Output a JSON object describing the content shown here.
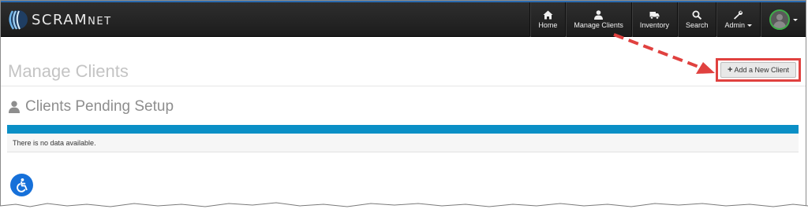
{
  "brand": {
    "name_main": "SCRAM",
    "name_suffix": "NET",
    "logo_icon": "scram-swoosh-logo"
  },
  "nav": {
    "items": [
      {
        "label": "Home",
        "icon": "home-icon"
      },
      {
        "label": "Manage Clients",
        "icon": "user-icon"
      },
      {
        "label": "Inventory",
        "icon": "truck-icon"
      },
      {
        "label": "Search",
        "icon": "search-icon"
      },
      {
        "label": "Admin",
        "icon": "wrench-icon",
        "has_dropdown": true
      }
    ],
    "user_menu": {
      "icon": "avatar-icon",
      "has_dropdown": true
    }
  },
  "page": {
    "title": "Manage Clients",
    "add_button_label": "Add a New Client",
    "add_button_icon": "plus-icon"
  },
  "section": {
    "title": "Clients Pending Setup",
    "icon": "user-icon",
    "empty_message": "There is no data available."
  },
  "accessibility_button": {
    "icon": "accessibility-icon"
  },
  "colors": {
    "navbar": "#222222",
    "accent_blue": "#0a8fc6",
    "highlight_red": "#e0413f",
    "avatar_ring": "#3fae49",
    "a11y_blue": "#1670d9"
  }
}
